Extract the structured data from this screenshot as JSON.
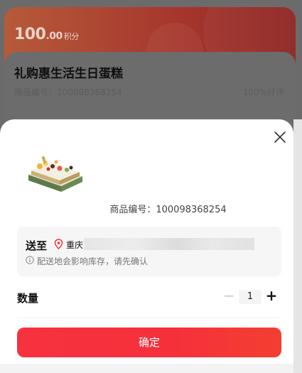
{
  "background": {
    "points": {
      "integer": "100",
      "decimal": ".00",
      "unit": "积分"
    },
    "product": {
      "title": "礼购惠生活生日蛋糕",
      "code_text": "商品编号：100098368254",
      "good_rate": "100%好评"
    }
  },
  "sheet": {
    "product_code": "商品编号：100098368254",
    "address": {
      "label": "送至",
      "city": "重庆",
      "note": "配送地会影响库存，请先确认"
    },
    "quantity": {
      "label": "数量",
      "minus": "−",
      "value": "1",
      "plus": "+"
    },
    "confirm_label": "确定"
  },
  "colors": {
    "accent": "#f5303b",
    "location": "#f5303b"
  },
  "icons": [
    "close-icon",
    "location-pin-icon",
    "info-icon",
    "product-thumbnail"
  ]
}
